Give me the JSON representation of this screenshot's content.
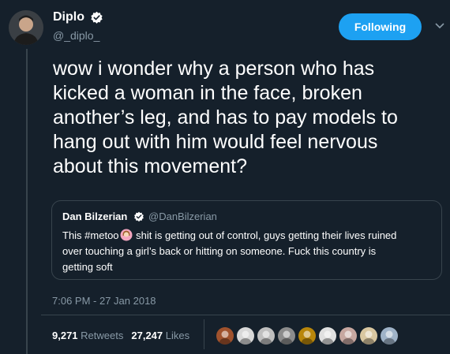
{
  "author": {
    "name": "Diplo",
    "handle": "@_diplo_",
    "verified": true,
    "avatar_icon": "person-avatar-icon"
  },
  "follow_button": {
    "label": "Following",
    "color": "#1da1f2"
  },
  "tweet": {
    "lines": [
      "wow i wonder why a person who has",
      "kicked a woman in the face, broken",
      "another’s leg, and has to pay models to",
      "hang out with him would feel nervous",
      "about this movement?"
    ]
  },
  "quoted_tweet": {
    "name": "Dan Bilzerian",
    "handle": "@DanBilzerian",
    "verified": true,
    "text_part1": "This #metoo",
    "emoji": "woman-emoji-icon",
    "text_part2": " shit is getting out of control, guys getting their lives ruined",
    "line2": "over touching a girl’s back or hitting on someone.  Fuck this country is",
    "line3": "getting soft"
  },
  "timestamp": "7:06 PM - 27 Jan 2018",
  "stats": {
    "retweets_count": "9,271",
    "retweets_label": "Retweets",
    "likes_count": "27,247",
    "likes_label": "Likes"
  },
  "likers": [
    {
      "icon": "liker-avatar-icon",
      "color": "#a0522d"
    },
    {
      "icon": "liker-avatar-icon",
      "color": "#d8d8d8"
    },
    {
      "icon": "liker-avatar-icon",
      "color": "#bfbfbf"
    },
    {
      "icon": "liker-avatar-icon",
      "color": "#8c8c8c"
    },
    {
      "icon": "liker-avatar-icon",
      "color": "#b8860b"
    },
    {
      "icon": "liker-avatar-icon",
      "color": "#e0e0e0"
    },
    {
      "icon": "liker-avatar-icon",
      "color": "#c7a7a0"
    },
    {
      "icon": "liker-avatar-icon",
      "color": "#d9c7a0"
    },
    {
      "icon": "liker-avatar-icon",
      "color": "#9fb3c8"
    }
  ],
  "colors": {
    "background": "#15202b",
    "muted_text": "#8899a6",
    "border": "#38444d",
    "verified_badge": "#ffffff"
  }
}
